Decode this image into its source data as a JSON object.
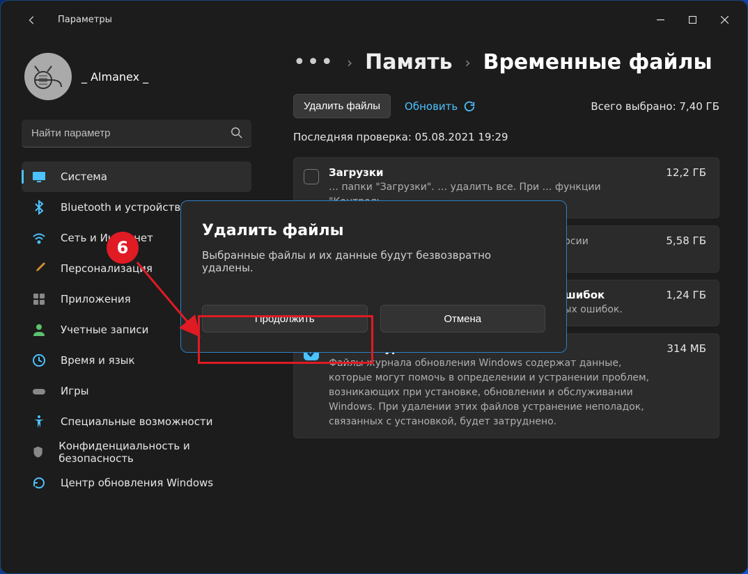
{
  "app_title": "Параметры",
  "profile": {
    "name": "_ Almanex _"
  },
  "search": {
    "placeholder": "Найти параметр"
  },
  "sidebar": {
    "items": [
      {
        "label": "Система",
        "icon": "display",
        "active": true,
        "color": "#4cc2ff"
      },
      {
        "label": "Bluetooth и устройства",
        "icon": "bluetooth",
        "color": "#4cc2ff"
      },
      {
        "label": "Сеть и Интернет",
        "icon": "wifi",
        "color": "#4cc2ff"
      },
      {
        "label": "Персонализация",
        "icon": "brush",
        "color": "#d98f2e"
      },
      {
        "label": "Приложения",
        "icon": "apps",
        "color": "#888"
      },
      {
        "label": "Учетные записи",
        "icon": "person",
        "color": "#5ec26e"
      },
      {
        "label": "Время и язык",
        "icon": "clock",
        "color": "#4cc2ff"
      },
      {
        "label": "Игры",
        "icon": "gamepad",
        "color": "#888"
      },
      {
        "label": "Специальные возможности",
        "icon": "accessibility",
        "color": "#4cc2ff"
      },
      {
        "label": "Конфиденциальность и безопасность",
        "icon": "shield",
        "color": "#888"
      },
      {
        "label": "Центр обновления Windows",
        "icon": "update",
        "color": "#4cc2ff"
      }
    ]
  },
  "breadcrumb": {
    "parent": "Память",
    "current": "Временные файлы"
  },
  "toolbar": {
    "delete_label": "Удалить файлы",
    "refresh_label": "Обновить",
    "total_label": "Всего выбрано: 7,40 ГБ"
  },
  "lastcheck": "Последняя проверка: 05.08.2021 19:29",
  "items": [
    {
      "title": "Загрузки",
      "size": "12,2 ГБ",
      "checked": false,
      "desc": "… папки \"Загрузки\". … удалить все. При … функции \"Контроль …"
    },
    {
      "title": "",
      "size": "5,58 ГБ",
      "checked": true,
      "desc": "… обновлений из … установки их новых … версии обновлений … потребуется"
    },
    {
      "title": "Файлы дампа памяти для системных ошибок",
      "size": "1,24 ГБ",
      "checked": true,
      "desc": "Удаление файлов дампа памяти для системных ошибок."
    },
    {
      "title": "Файлы журнала обновления Windows",
      "size": "314 МБ",
      "checked": true,
      "desc": "Файлы журнала обновления Windows содержат данные, которые могут помочь в определении и устранении проблем, возникающих при установке, обновлении и обслуживании Windows. При удалении этих файлов устранение неполадок, связанных с установкой, будет затруднено."
    }
  ],
  "modal": {
    "title": "Удалить файлы",
    "message": "Выбранные файлы и их данные будут безвозвратно удалены.",
    "continue": "Продолжить",
    "cancel": "Отмена"
  },
  "annotation": {
    "number": "6"
  }
}
